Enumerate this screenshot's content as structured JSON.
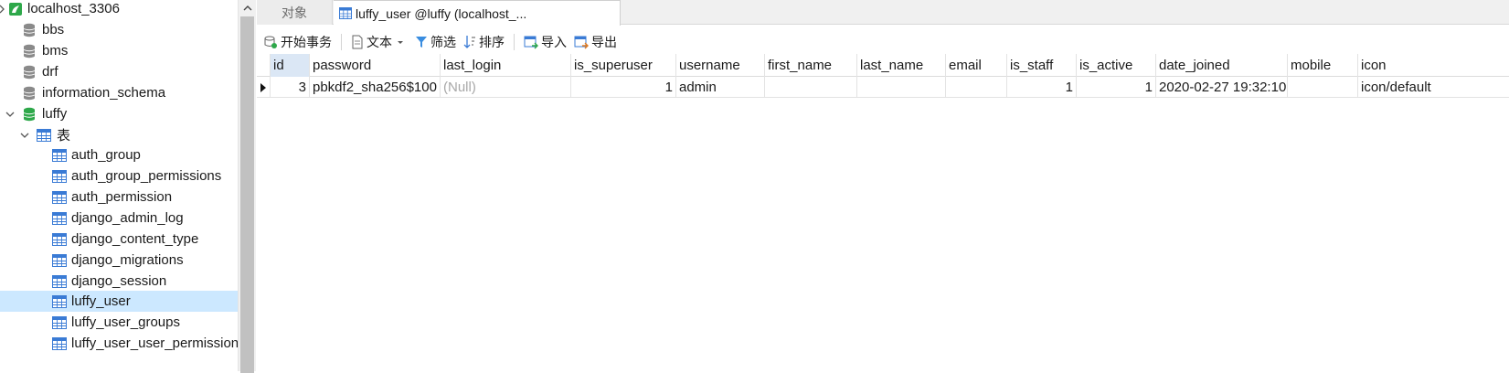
{
  "nav": {
    "items": [
      {
        "label": "localhost_3306",
        "icon": "server-connection-icon"
      },
      {
        "label": "bbs",
        "icon": "database-icon"
      },
      {
        "label": "bms",
        "icon": "database-icon"
      },
      {
        "label": "drf",
        "icon": "database-icon"
      },
      {
        "label": "information_schema",
        "icon": "database-icon"
      },
      {
        "label": "luffy",
        "icon": "database-open-icon"
      },
      {
        "label": "表",
        "icon": "tables-folder-icon"
      },
      {
        "label": "auth_group",
        "icon": "table-icon"
      },
      {
        "label": "auth_group_permissions",
        "icon": "table-icon"
      },
      {
        "label": "auth_permission",
        "icon": "table-icon"
      },
      {
        "label": "django_admin_log",
        "icon": "table-icon"
      },
      {
        "label": "django_content_type",
        "icon": "table-icon"
      },
      {
        "label": "django_migrations",
        "icon": "table-icon"
      },
      {
        "label": "django_session",
        "icon": "table-icon"
      },
      {
        "label": "luffy_user",
        "icon": "table-icon"
      },
      {
        "label": "luffy_user_groups",
        "icon": "table-icon"
      },
      {
        "label": "luffy_user_user_permission",
        "icon": "table-icon"
      }
    ],
    "selected_item": "luffy_user"
  },
  "tabs": {
    "objects": "对象",
    "active": "luffy_user @luffy (localhost_..."
  },
  "toolbar": {
    "begin_transaction": "开始事务",
    "text": "文本",
    "filter": "筛选",
    "sort": "排序",
    "import": "导入",
    "export": "导出"
  },
  "grid": {
    "columns": [
      "id",
      "password",
      "last_login",
      "is_superuser",
      "username",
      "first_name",
      "last_name",
      "email",
      "is_staff",
      "is_active",
      "date_joined",
      "mobile",
      "icon"
    ],
    "rows": [
      {
        "id": "3",
        "password": "pbkdf2_sha256$100",
        "last_login": "(Null)",
        "is_superuser": "1",
        "username": "admin",
        "first_name": "",
        "last_name": "",
        "email": "",
        "is_staff": "1",
        "is_active": "1",
        "date_joined": "2020-02-27 19:32:10",
        "mobile": "",
        "icon": "icon/default"
      }
    ]
  },
  "colors": {
    "selection": "#cce8ff",
    "db_green": "#2ea84a",
    "table_blue": "#3a7bd5",
    "null_gray": "#a8a8a8"
  }
}
